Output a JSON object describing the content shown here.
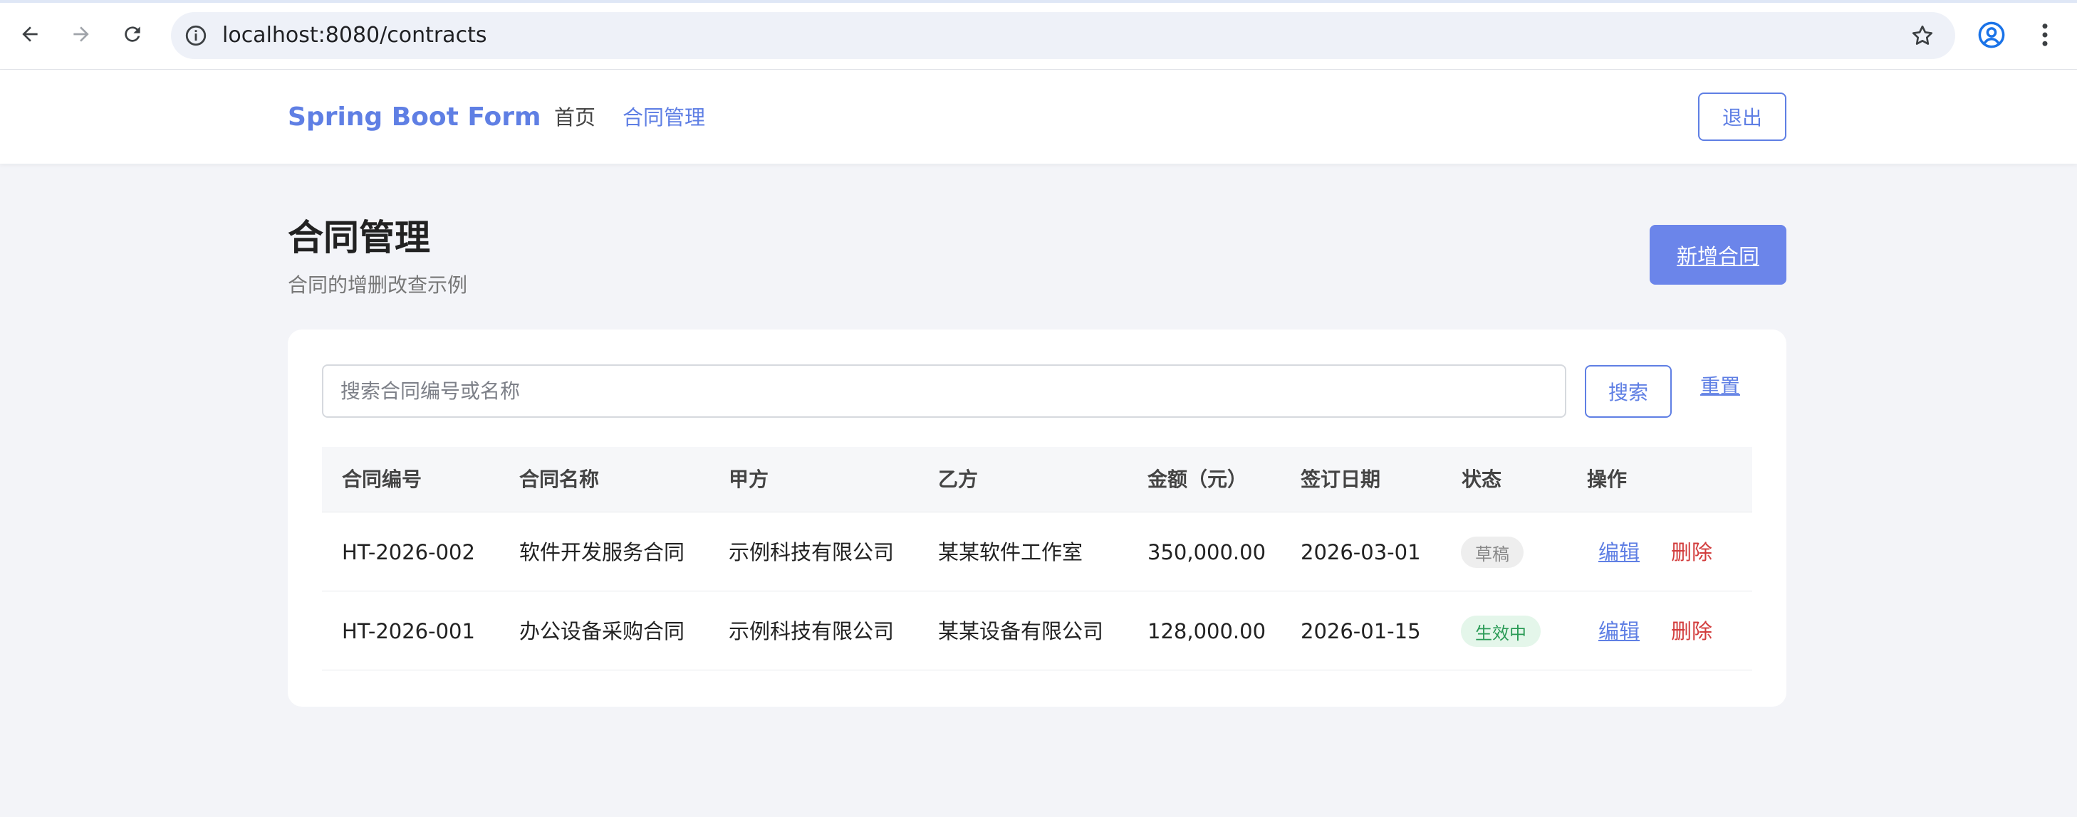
{
  "browser": {
    "url": "localhost:8080/contracts"
  },
  "header": {
    "brand": "Spring Boot Form",
    "nav": [
      {
        "label": "首页"
      },
      {
        "label": "合同管理"
      }
    ],
    "logout_label": "退出"
  },
  "page": {
    "title": "合同管理",
    "subtitle": "合同的增删改查示例",
    "add_label": "新增合同"
  },
  "search": {
    "placeholder": "搜索合同编号或名称",
    "button_label": "搜索",
    "reset_label": "重置"
  },
  "table": {
    "columns": [
      "合同编号",
      "合同名称",
      "甲方",
      "乙方",
      "金额（元）",
      "签订日期",
      "状态",
      "操作"
    ],
    "rows": [
      {
        "code": "HT-2026-002",
        "name": "软件开发服务合同",
        "party_a": "示例科技有限公司",
        "party_b": "某某软件工作室",
        "amount": "350,000.00",
        "date": "2026-03-01",
        "status": "草稿",
        "edit": "编辑",
        "delete": "删除"
      },
      {
        "code": "HT-2026-001",
        "name": "办公设备采购合同",
        "party_a": "示例科技有限公司",
        "party_b": "某某设备有限公司",
        "amount": "128,000.00",
        "date": "2026-01-15",
        "status": "生效中",
        "edit": "编辑",
        "delete": "删除"
      }
    ]
  },
  "colors": {
    "accent": "#5f7fe4",
    "primary_button": "#6b85ea",
    "danger": "#d23c3c",
    "success": "#2a9b56",
    "page_bg": "#f3f4f8"
  }
}
